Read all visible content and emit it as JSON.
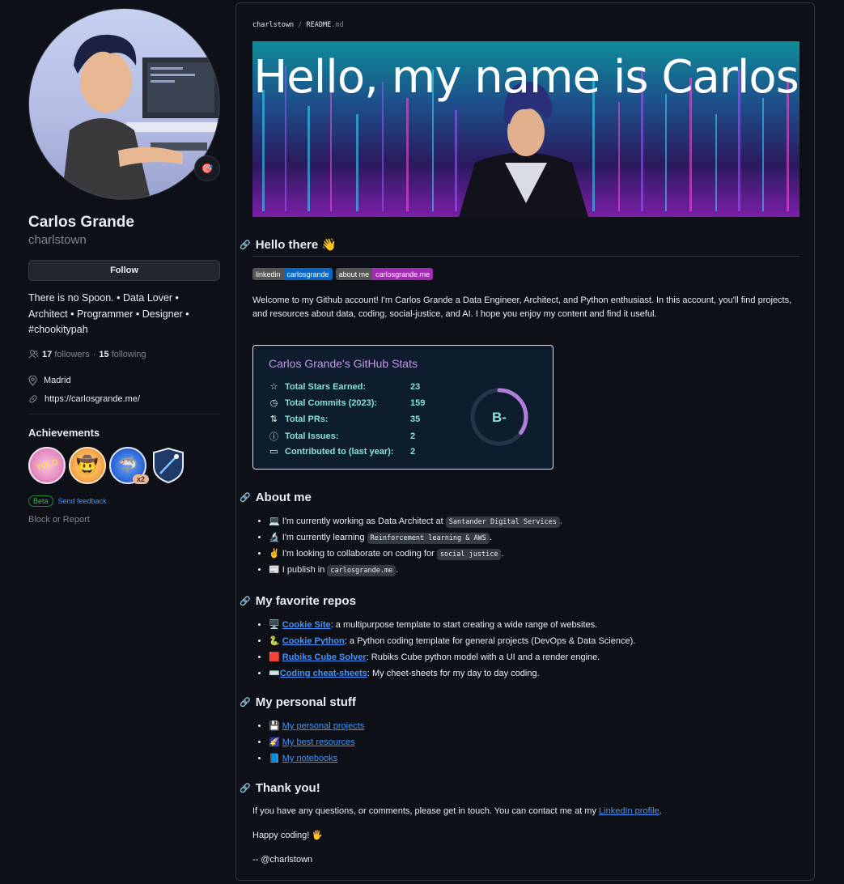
{
  "profile": {
    "full_name": "Carlos Grande",
    "login": "charlstown",
    "follow_label": "Follow",
    "bio": "There is no Spoon. • Data Lover • Architect • Programmer • Designer • #chookitypah",
    "followers_count": "17",
    "followers_label": "followers",
    "separator": "·",
    "following_count": "15",
    "following_label": "following",
    "location": "Madrid",
    "website": "https://carlosgrande.me/",
    "status_emoji": "🎯"
  },
  "achievements": {
    "title": "Achievements",
    "badges": [
      {
        "name": "yolo",
        "text": "YOLO"
      },
      {
        "name": "quickdraw",
        "text": "🤠"
      },
      {
        "name": "pull-shark",
        "text": "🦈"
      },
      {
        "name": "arctic",
        "text": ""
      }
    ],
    "multiplier": "x2",
    "beta_label": "Beta",
    "feedback_label": "Send feedback"
  },
  "block_label": "Block or Report",
  "readme": {
    "breadcrumb_user": "charlstown",
    "breadcrumb_sep": " / ",
    "breadcrumb_file": "README",
    "breadcrumb_ext": ".md",
    "banner_title": "Hello, my name is Carlos",
    "hello_heading": "Hello there 👋",
    "shields": [
      {
        "label": "linkedin",
        "value": "carlosgrande",
        "value_color": "#0a66c2",
        "label_color": "#555555"
      },
      {
        "label": "about me",
        "value": "carlosgrande.me",
        "value_color": "#a12bb0",
        "label_color": "#555555"
      }
    ],
    "intro": "Welcome to my Github account! I'm Carlos Grande a Data Engineer, Architect, and Python enthusiast. In this account, you'll find projects, and resources about data, coding, social-justice, and AI. I hope you enjoy my content and find it useful.",
    "stats": {
      "title": "Carlos Grande's GitHub Stats",
      "rows": [
        {
          "icon": "☆",
          "label": "Total Stars Earned:",
          "value": "23"
        },
        {
          "icon": "◷",
          "label": "Total Commits (2023):",
          "value": "159"
        },
        {
          "icon": "⇅",
          "label": "Total PRs:",
          "value": "35"
        },
        {
          "icon": "ⓘ",
          "label": "Total Issues:",
          "value": "2"
        },
        {
          "icon": "▭",
          "label": "Contributed to (last year):",
          "value": "2"
        }
      ],
      "grade": "B-",
      "grade_progress": 0.35
    },
    "about_heading": "About me",
    "about_items": [
      {
        "emoji": "💻",
        "text": "I'm currently working as Data Architect at",
        "code": "Santander Digital Services",
        "end": "."
      },
      {
        "emoji": "🔬",
        "text": "I'm currently learning",
        "code": "Reinforcement learning & AWS",
        "end": "."
      },
      {
        "emoji": "✌️",
        "text": "I'm looking to collaborate on coding for",
        "code": "social justice",
        "end": "."
      },
      {
        "emoji": "📰",
        "text": "I publish in",
        "code": "carlosgrande.me",
        "end": "."
      }
    ],
    "repos_heading": "My favorite repos",
    "repos": [
      {
        "emoji": "🖥️",
        "name": "Cookie Site",
        "desc": ": a multipurpose template to start creating a wide range of websites."
      },
      {
        "emoji": "🐍",
        "name": "Cookie Python",
        "desc": ": a Python coding template for general projects (DevOps & Data Science)."
      },
      {
        "emoji": "🟥",
        "name": "Rubiks Cube Solver",
        "desc": ": Rubiks Cube python model with a UI and a render engine."
      },
      {
        "emoji": "⌨️",
        "name": "Coding cheat-sheets",
        "desc": ": My cheet-sheets for my day to day coding."
      }
    ],
    "personal_heading": "My personal stuff",
    "personal": [
      {
        "emoji": "💾",
        "name": "My personal projects"
      },
      {
        "emoji": "🌠",
        "name": "My best resources"
      },
      {
        "emoji": "📘",
        "name": "My notebooks"
      }
    ],
    "thanks_heading": "Thank you!",
    "thanks_text": "If you have any questions, or comments, please get in touch. You can contact me at my",
    "thanks_link": "LinkedIn profile",
    "thanks_end": ".",
    "happy": "Happy coding! 🖐️",
    "signature": "-- @charlstown"
  },
  "colors": {
    "bg": "#0d1117",
    "link": "#4493f8",
    "stats_title": "#c792ea",
    "stats_text": "#86e1d4"
  }
}
